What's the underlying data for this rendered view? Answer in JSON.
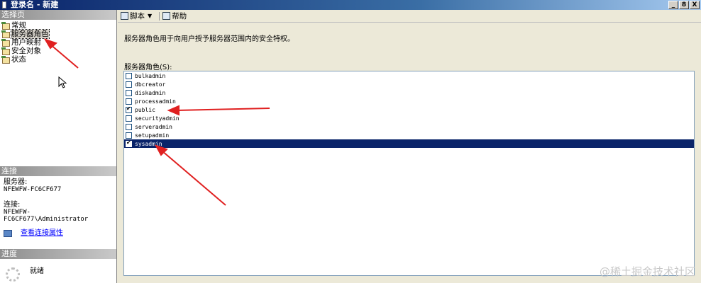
{
  "window": {
    "title": "登录名 - 新建",
    "buttons": [
      "_",
      "8",
      "X"
    ]
  },
  "left": {
    "select_page_header": "选择页",
    "pages": [
      {
        "label": "常规",
        "icon": "page-icon"
      },
      {
        "label": "服务器角色",
        "icon": "page-icon",
        "selected": true
      },
      {
        "label": "用户映射",
        "icon": "page-icon"
      },
      {
        "label": "安全对象",
        "icon": "page-icon"
      },
      {
        "label": "状态",
        "icon": "page-icon"
      }
    ],
    "connection": {
      "header": "连接",
      "server_label": "服务器:",
      "server_value": "NFEWFW-FC6CF677",
      "connection_label": "连接:",
      "connection_value": "NFEWFW-FC6CF677\\Administrator",
      "link_text": "查看连接属性"
    },
    "progress": {
      "header": "进度",
      "status": "就绪"
    }
  },
  "toolbar": {
    "script_label": "脚本",
    "help_label": "帮助"
  },
  "main": {
    "description": "服务器角色用于向用户授予服务器范围内的安全特权。",
    "roles_label": "服务器角色(S):",
    "roles": [
      {
        "name": "bulkadmin",
        "checked": false
      },
      {
        "name": "dbcreator",
        "checked": false
      },
      {
        "name": "diskadmin",
        "checked": false
      },
      {
        "name": "processadmin",
        "checked": false
      },
      {
        "name": "public",
        "checked": true
      },
      {
        "name": "securityadmin",
        "checked": false
      },
      {
        "name": "serveradmin",
        "checked": false
      },
      {
        "name": "setupadmin",
        "checked": false
      },
      {
        "name": "sysadmin",
        "checked": true,
        "selected": true
      }
    ]
  },
  "annotation_color": "#e02020",
  "watermark": "@稀土掘金技术社区"
}
